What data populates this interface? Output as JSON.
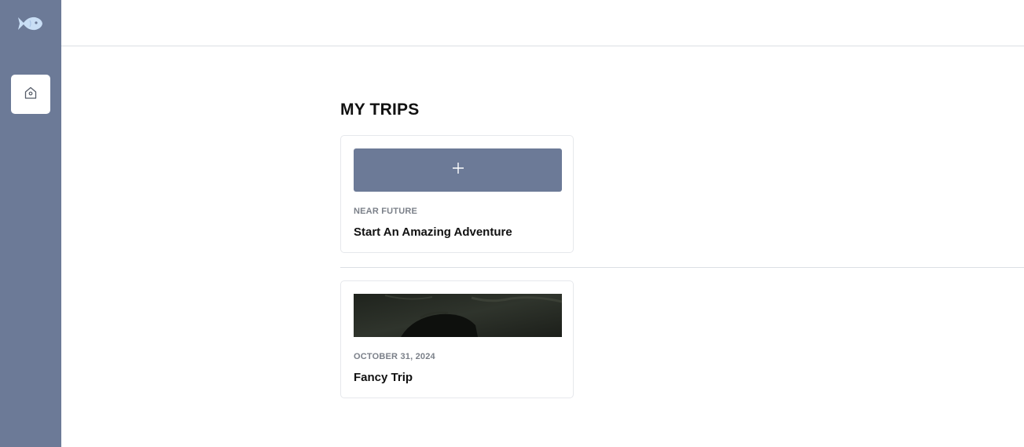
{
  "sidebar": {
    "logo_icon": "fish-icon",
    "home_icon": "home-icon",
    "background_color": "#6c7a97"
  },
  "main": {
    "title": "MY TRIPS",
    "new_trip_card": {
      "icon": "plus-icon",
      "date_label": "NEAR FUTURE",
      "title": "Start An Amazing Adventure"
    },
    "trips": [
      {
        "date_label": "OCTOBER 31, 2024",
        "title": "Fancy Trip"
      }
    ]
  }
}
